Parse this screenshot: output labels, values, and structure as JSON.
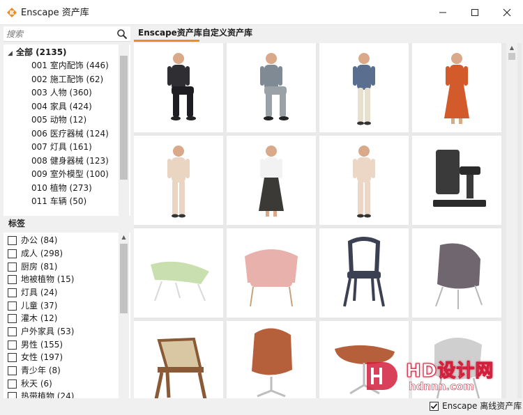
{
  "window": {
    "title": "Enscape 资产库",
    "accent": "#f08a24"
  },
  "search": {
    "placeholder": "搜索"
  },
  "tree": {
    "root_label": "全部 (2135)",
    "items": [
      "001 室内配饰 (446)",
      "002 施工配饰 (62)",
      "003 人物 (360)",
      "004 家具 (424)",
      "005 动物 (12)",
      "006 医疗器械 (124)",
      "007 灯具 (161)",
      "008 健身器械 (123)",
      "009 室外模型 (100)",
      "010 植物 (273)",
      "011 车辆 (50)"
    ]
  },
  "tags": {
    "header": "标签",
    "items": [
      "办公 (84)",
      "成人 (298)",
      "厨房 (81)",
      "地被植物 (15)",
      "灯具 (24)",
      "儿童 (37)",
      "灌木 (12)",
      "户外家具 (53)",
      "男性 (155)",
      "女性 (197)",
      "青少年 (8)",
      "秋天 (6)",
      "热带植物 (24)"
    ]
  },
  "tabs": [
    "Enscape资产库",
    "自定义资产库"
  ],
  "assets": [
    {
      "icon": "seated-man-icon",
      "colors": [
        "#2f2f33",
        "#1e1e22"
      ]
    },
    {
      "icon": "seated-man-phone-icon",
      "colors": [
        "#7f8a94",
        "#9aa2a8"
      ]
    },
    {
      "icon": "standing-man-phone-icon",
      "colors": [
        "#5a6f8f",
        "#e8e0cf"
      ]
    },
    {
      "icon": "standing-woman-dress-icon",
      "colors": [
        "#d25a2b",
        "#d25a2b"
      ]
    },
    {
      "icon": "standing-woman-suit-icon",
      "colors": [
        "#ead5c2",
        "#ead5c2"
      ]
    },
    {
      "icon": "standing-woman-apron-icon",
      "colors": [
        "#f2f2f2",
        "#3b3a37"
      ]
    },
    {
      "icon": "standing-woman-bag-icon",
      "colors": [
        "#ecd7c6",
        "#ecd7c6"
      ]
    },
    {
      "icon": "fitness-machine-icon",
      "colors": [
        "#3a3a3a",
        "#2a2a2a"
      ]
    },
    {
      "icon": "lounge-chair-green-icon",
      "colors": [
        "#c9dfb0",
        "#d8d8d8"
      ]
    },
    {
      "icon": "armchair-pink-icon",
      "colors": [
        "#e9b1ab",
        "#c9a27a"
      ]
    },
    {
      "icon": "ghost-chair-icon",
      "colors": [
        "#3b4052",
        "#3b4052"
      ]
    },
    {
      "icon": "shell-chair-icon",
      "colors": [
        "#6f6670",
        "#b8b8b8"
      ]
    },
    {
      "icon": "wooden-chair-icon",
      "colors": [
        "#8a5a36",
        "#d9c7a4"
      ]
    },
    {
      "icon": "egg-chair-icon",
      "colors": [
        "#b5603a",
        "#bdbdbd"
      ]
    },
    {
      "icon": "ottoman-icon",
      "colors": [
        "#b5603a",
        "#bdbdbd"
      ]
    },
    {
      "icon": "womb-chair-icon",
      "colors": [
        "#cfcfcf",
        "#bdbdbd"
      ]
    }
  ],
  "watermark": {
    "title": "HD设计网",
    "url": "hdnnn.com"
  },
  "footer": {
    "offline_label": "Enscape 离线资产库",
    "offline_checked": true
  }
}
